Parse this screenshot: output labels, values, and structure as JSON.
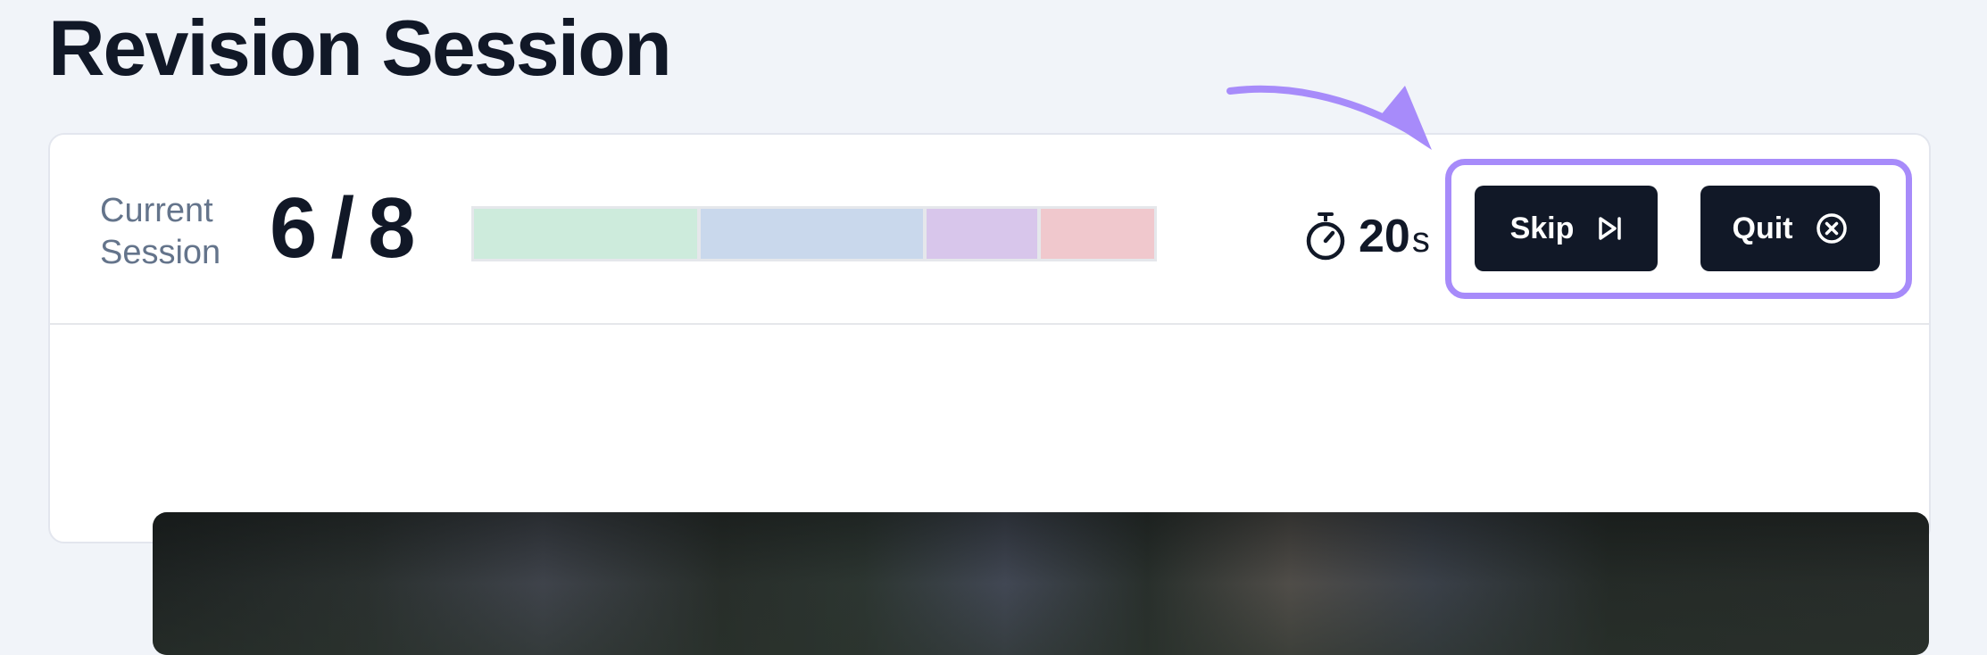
{
  "page": {
    "title": "Revision Session"
  },
  "session": {
    "label": "Current Session",
    "current": "6",
    "separator": "/",
    "total": "8",
    "progress_segments": [
      {
        "color": "#cdebdc",
        "fraction": 0.333
      },
      {
        "color": "#c9d8ec",
        "fraction": 0.333
      },
      {
        "color": "#d8c6eb",
        "fraction": 0.167
      },
      {
        "color": "#f0c8cd",
        "fraction": 0.167
      }
    ]
  },
  "timer": {
    "icon": "stopwatch-icon",
    "value": "20",
    "unit": "s"
  },
  "actions": {
    "skip_label": "Skip",
    "skip_icon": "skip-forward-icon",
    "quit_label": "Quit",
    "quit_icon": "close-circle-icon"
  },
  "colors": {
    "accent": "#a78bfa",
    "button_bg": "#111827",
    "page_bg": "#f1f4f9"
  }
}
